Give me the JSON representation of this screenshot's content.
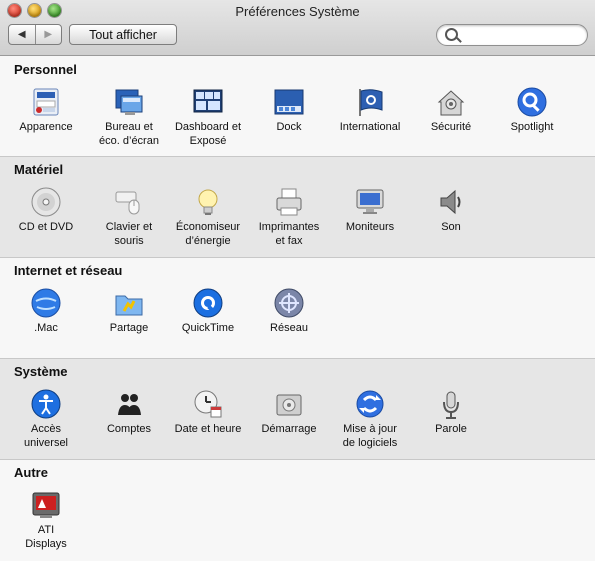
{
  "window": {
    "title": "Préférences Système"
  },
  "toolbar": {
    "back_label": "◀",
    "forward_label": "▶",
    "show_all_label": "Tout afficher",
    "search_placeholder": ""
  },
  "sections": [
    {
      "title": "Personnel",
      "items": [
        {
          "label": "Apparence",
          "icon": "appearance-icon"
        },
        {
          "label": "Bureau et\néco. d’écran",
          "icon": "desktop-screensaver-icon"
        },
        {
          "label": "Dashboard et\nExposé",
          "icon": "dashboard-expose-icon"
        },
        {
          "label": "Dock",
          "icon": "dock-icon"
        },
        {
          "label": "International",
          "icon": "international-flag-icon"
        },
        {
          "label": "Sécurité",
          "icon": "security-house-icon"
        },
        {
          "label": "Spotlight",
          "icon": "spotlight-icon"
        }
      ]
    },
    {
      "title": "Matériel",
      "items": [
        {
          "label": "CD et DVD",
          "icon": "cd-dvd-icon"
        },
        {
          "label": "Clavier et\nsouris",
          "icon": "keyboard-mouse-icon"
        },
        {
          "label": "Économiseur\nd’énergie",
          "icon": "energy-saver-bulb-icon"
        },
        {
          "label": "Imprimantes\net fax",
          "icon": "printer-fax-icon"
        },
        {
          "label": "Moniteurs",
          "icon": "monitor-icon"
        },
        {
          "label": "Son",
          "icon": "speaker-icon"
        }
      ]
    },
    {
      "title": "Internet et réseau",
      "items": [
        {
          "label": ".Mac",
          "icon": "dotmac-globe-icon"
        },
        {
          "label": "Partage",
          "icon": "sharing-folder-icon"
        },
        {
          "label": "QuickTime",
          "icon": "quicktime-icon"
        },
        {
          "label": "Réseau",
          "icon": "network-globe-icon"
        }
      ]
    },
    {
      "title": "Système",
      "items": [
        {
          "label": "Accès\nuniversel",
          "icon": "universal-access-icon"
        },
        {
          "label": "Comptes",
          "icon": "accounts-icon"
        },
        {
          "label": "Date et heure",
          "icon": "date-time-clock-icon"
        },
        {
          "label": "Démarrage",
          "icon": "startup-disk-icon"
        },
        {
          "label": "Mise à jour\nde logiciels",
          "icon": "software-update-icon"
        },
        {
          "label": "Parole",
          "icon": "speech-microphone-icon"
        }
      ]
    },
    {
      "title": "Autre",
      "items": [
        {
          "label": "ATI\nDisplays",
          "icon": "ati-displays-icon"
        }
      ]
    }
  ]
}
